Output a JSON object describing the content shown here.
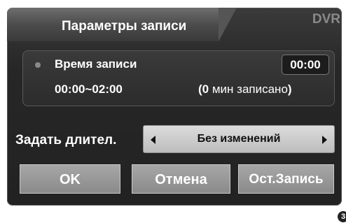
{
  "dialog": {
    "title": "Параметры записи",
    "source_tag": "DVR"
  },
  "recording": {
    "label": "Время записи",
    "time": "00:00",
    "range": "00:00~02:00",
    "count_open": "(0",
    "count_text": "мин записано",
    "count_close": ")"
  },
  "duration": {
    "label": "Задать длител.",
    "value": "Без изменений"
  },
  "buttons": {
    "ok": "OK",
    "cancel": "Отмена",
    "stop": "Ост.Запись"
  },
  "page_badge": "3"
}
